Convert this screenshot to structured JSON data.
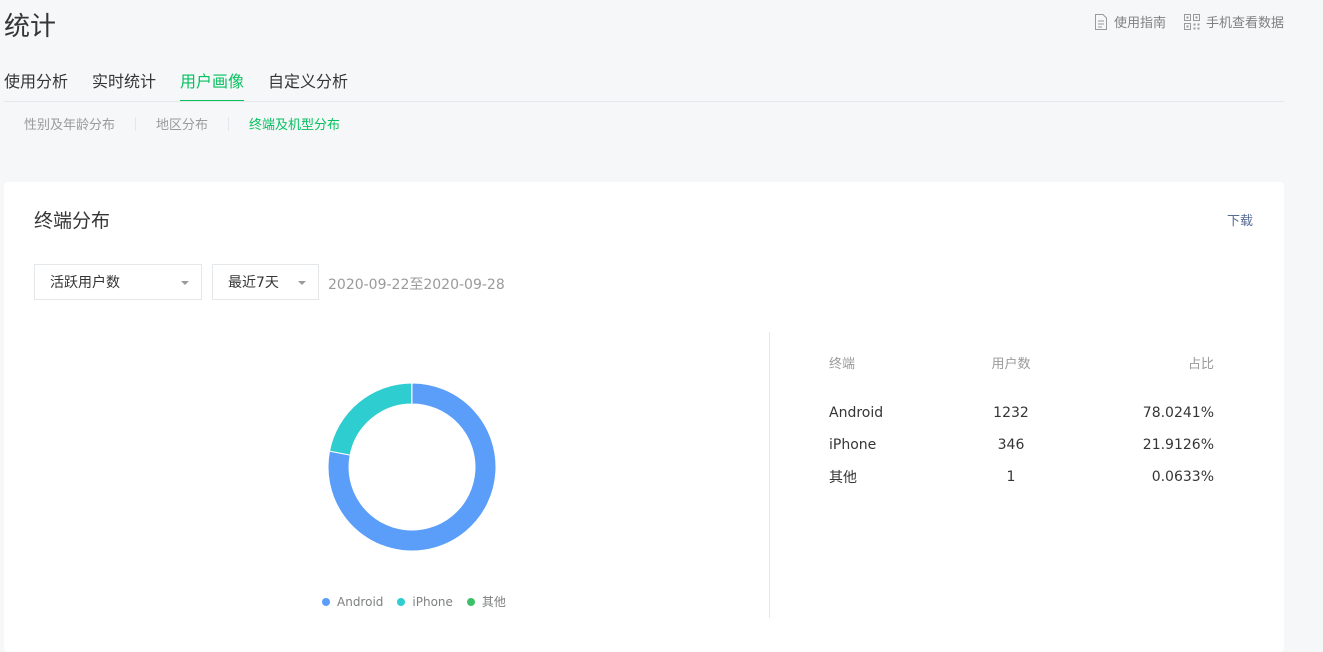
{
  "page": {
    "title": "统计"
  },
  "top_links": [
    {
      "label": "使用指南",
      "icon": "document-icon"
    },
    {
      "label": "手机查看数据",
      "icon": "qrcode-icon"
    }
  ],
  "main_tabs": [
    {
      "label": "使用分析",
      "active": false
    },
    {
      "label": "实时统计",
      "active": false
    },
    {
      "label": "用户画像",
      "active": true
    },
    {
      "label": "自定义分析",
      "active": false
    }
  ],
  "sub_tabs": [
    {
      "label": "性别及年龄分布",
      "active": false
    },
    {
      "label": "地区分布",
      "active": false
    },
    {
      "label": "终端及机型分布",
      "active": true
    }
  ],
  "card": {
    "title": "终端分布",
    "download_label": "下载",
    "metric_select": "活跃用户数",
    "period_select": "最近7天",
    "date_range": "2020-09-22至2020-09-28"
  },
  "table": {
    "headers": {
      "term": "终端",
      "users": "用户数",
      "ratio": "占比"
    },
    "rows": [
      {
        "term": "Android",
        "users": "1232",
        "ratio": "78.0241%"
      },
      {
        "term": "iPhone",
        "users": "346",
        "ratio": "21.9126%"
      },
      {
        "term": "其他",
        "users": "1",
        "ratio": "0.0633%"
      }
    ]
  },
  "colors": {
    "accent": "#07c160",
    "link": "#576b95",
    "android": "#5a9ef9",
    "iphone": "#2ecdcf",
    "other": "#3dc168"
  },
  "chart_data": {
    "type": "pie",
    "categories": [
      "Android",
      "iPhone",
      "其他"
    ],
    "values": [
      1232,
      346,
      1
    ],
    "colors": [
      "#5a9ef9",
      "#2ecdcf",
      "#3dc168"
    ],
    "legend": "bottom"
  }
}
